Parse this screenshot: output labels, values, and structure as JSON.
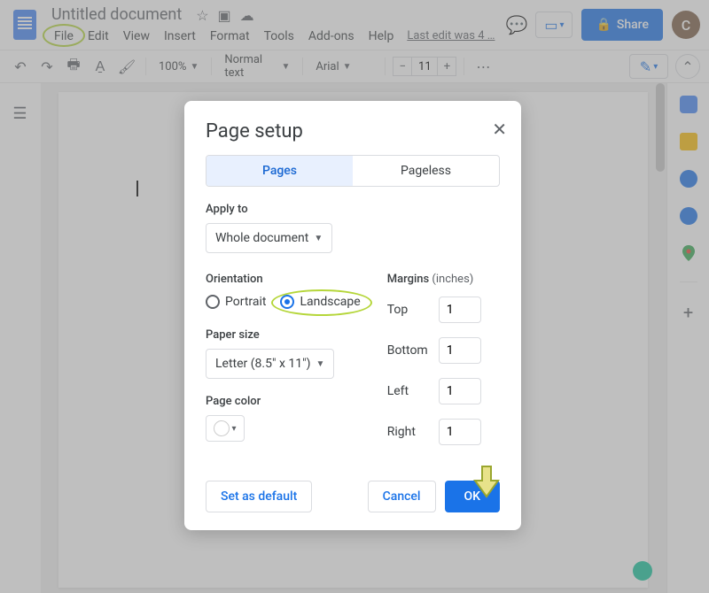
{
  "header": {
    "doc_title": "Untitled document",
    "menu": {
      "file": "File",
      "edit": "Edit",
      "view": "View",
      "insert": "Insert",
      "format": "Format",
      "tools": "Tools",
      "addons": "Add-ons",
      "help": "Help"
    },
    "last_edit": "Last edit was 4 …",
    "share_label": "Share",
    "avatar_letter": "C"
  },
  "toolbar": {
    "zoom": "100%",
    "style": "Normal text",
    "font": "Arial",
    "font_size": "11"
  },
  "dialog": {
    "title": "Page setup",
    "tab_pages": "Pages",
    "tab_pageless": "Pageless",
    "apply_to_label": "Apply to",
    "apply_to_value": "Whole document",
    "orientation_label": "Orientation",
    "portrait": "Portrait",
    "landscape": "Landscape",
    "paper_label": "Paper size",
    "paper_value": "Letter (8.5\" x 11\")",
    "page_color_label": "Page color",
    "margins_label": "Margins",
    "margins_unit": "(inches)",
    "margin_top_label": "Top",
    "margin_bottom_label": "Bottom",
    "margin_left_label": "Left",
    "margin_right_label": "Right",
    "margin_top": "1",
    "margin_bottom": "1",
    "margin_left": "1",
    "margin_right": "1",
    "set_default": "Set as default",
    "cancel": "Cancel",
    "ok": "OK"
  }
}
